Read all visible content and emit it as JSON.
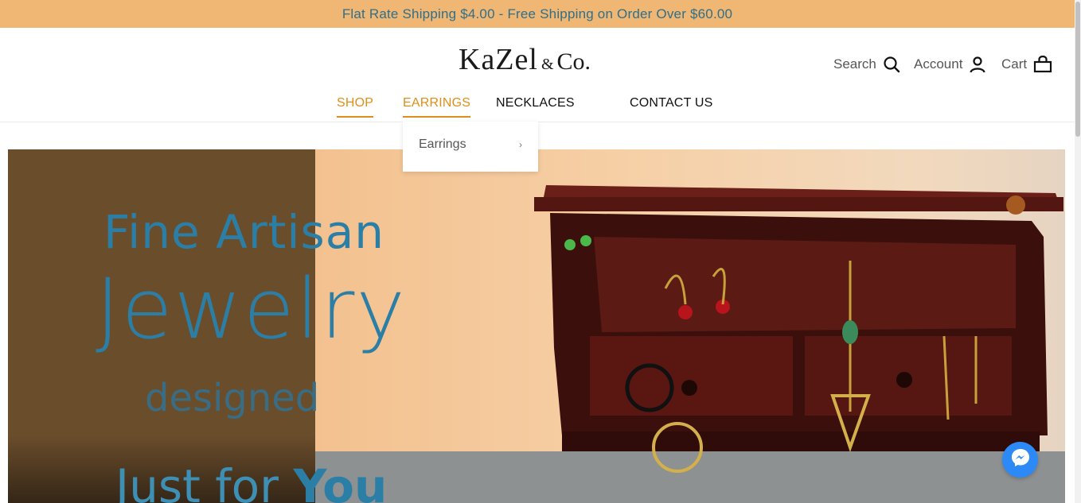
{
  "announcement": "Flat Rate Shipping $4.00 - Free Shipping on Order Over $60.00",
  "logo": {
    "main": "KaZel",
    "amp": "&",
    "co": "Co."
  },
  "header_links": {
    "search": "Search",
    "account": "Account",
    "cart": "Cart"
  },
  "nav": {
    "shop": "SHOP",
    "earrings": "EARRINGS",
    "necklaces": "NECKLACES",
    "contact": "CONTACT US"
  },
  "dropdown": {
    "item": "Earrings",
    "chevron": "›"
  },
  "hero": {
    "line1_a": "Fine Art",
    "line1_b": "isan",
    "line2": "Jewelry",
    "line3": "designed",
    "line4_a": "Just for ",
    "line4_b": "You"
  },
  "colors": {
    "announcement_bg": "#f0b673",
    "accent": "#e08e18",
    "hero_text": "#2b7fa6",
    "messenger": "#2d89f5"
  },
  "icons": [
    "search-icon",
    "account-icon",
    "cart-icon",
    "messenger-icon"
  ]
}
